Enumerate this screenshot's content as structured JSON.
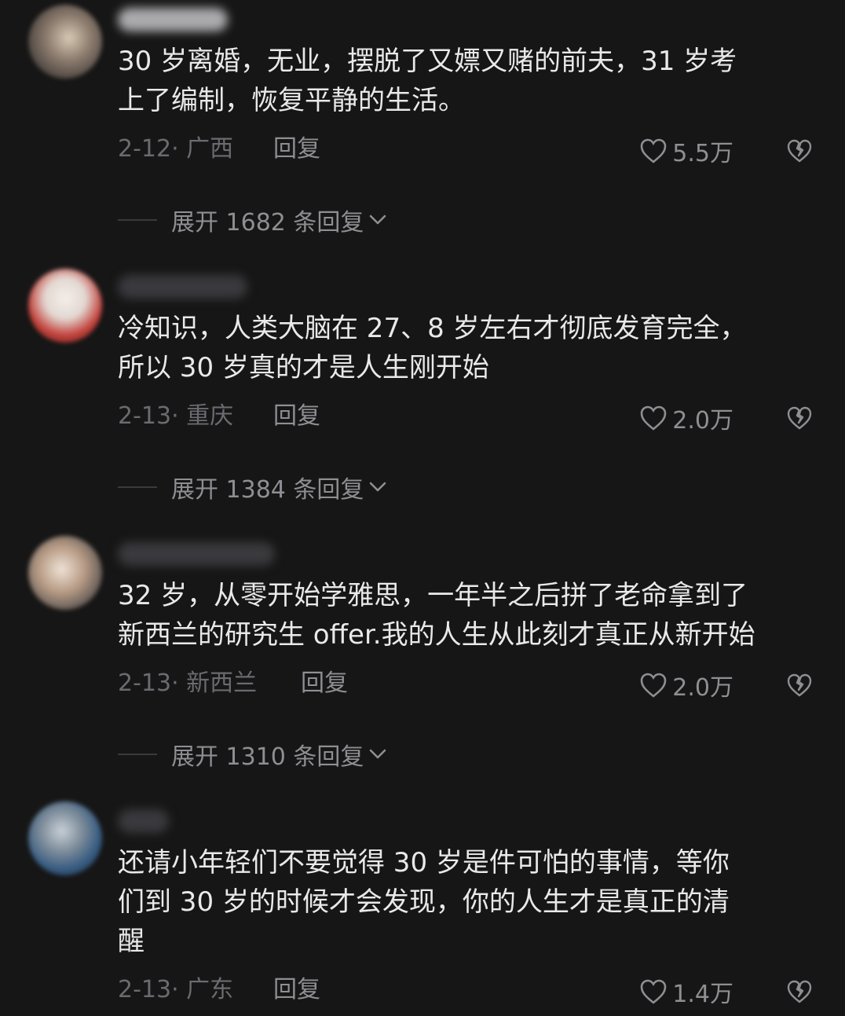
{
  "comments": [
    {
      "text": "30 岁离婚，无业，摆脱了又嫖又赌的前夫，31 岁考\n上了编制，恢复平静的生活。",
      "date": "2-12·",
      "location": "广西",
      "reply_label": "回复",
      "likes": "5.5万",
      "expand_label": "展开 1682 条回复"
    },
    {
      "text": "冷知识，人类大脑在 27、8 岁左右才彻底发育完全，\n所以 30 岁真的才是人生刚开始",
      "date": "2-13·",
      "location": "重庆",
      "reply_label": "回复",
      "likes": "2.0万",
      "expand_label": "展开 1384 条回复"
    },
    {
      "text": "32 岁，从零开始学雅思，一年半之后拼了老命拿到了\n新西兰的研究生 offer.我的人生从此刻才真正从新开始",
      "date": "2-13·",
      "location": "新西兰",
      "reply_label": "回复",
      "likes": "2.0万",
      "expand_label": "展开 1310 条回复"
    },
    {
      "text": "还请小年轻们不要觉得 30 岁是件可怕的事情，等你\n们到 30 岁的时候才会发现，你的人生才是真正的清\n醒",
      "date": "2-13·",
      "location": "广东",
      "reply_label": "回复",
      "likes": "1.4万"
    }
  ],
  "icons": {
    "like": "heart-outline-icon",
    "dislike": "broken-heart-icon",
    "expand": "chevron-down-icon"
  },
  "colors": {
    "background": "#161616",
    "text": "#e9e9ea",
    "muted": "#8e8e93"
  }
}
